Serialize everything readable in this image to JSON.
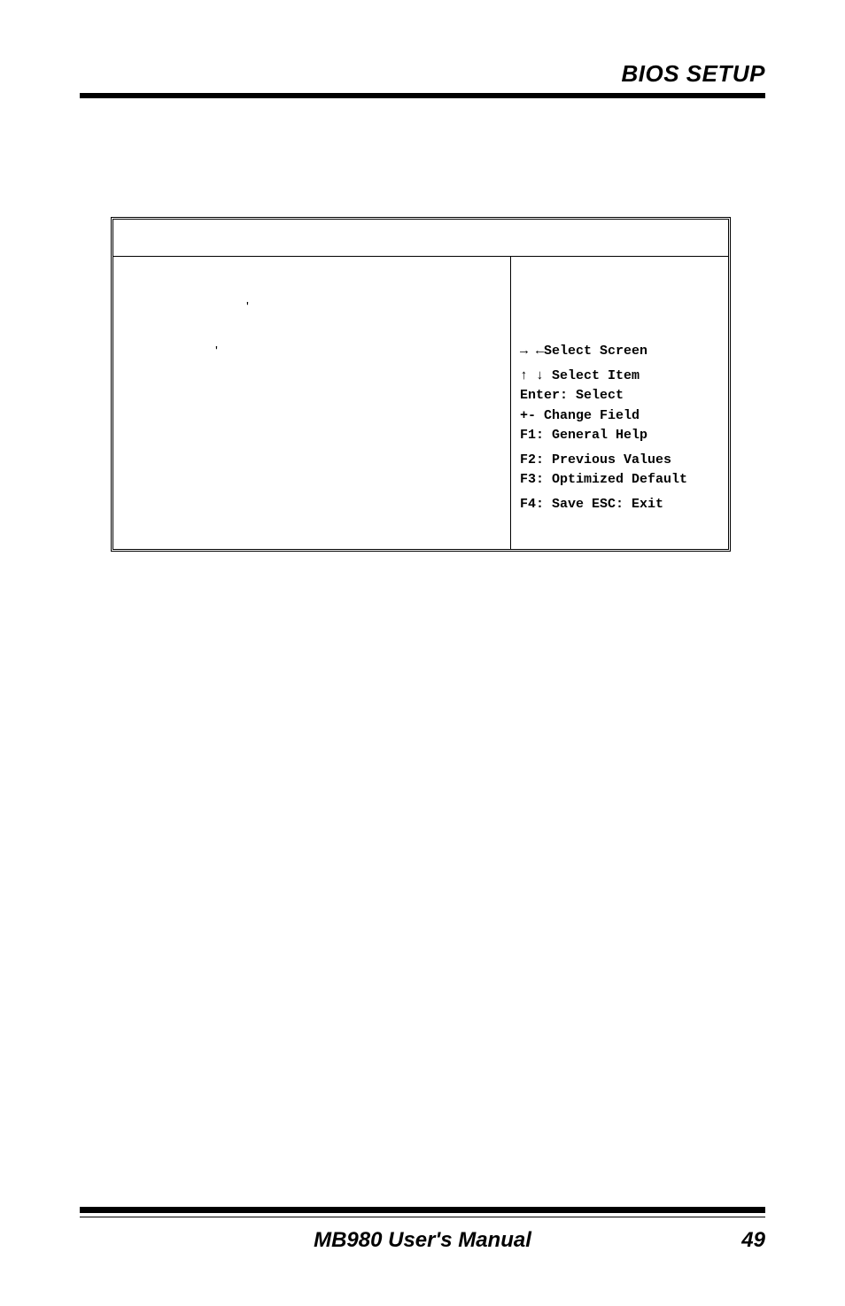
{
  "header": {
    "title": "BIOS SETUP"
  },
  "bios": {
    "help": {
      "select_screen": "→ ←Select Screen",
      "select_item": "↑ ↓ Select Item",
      "enter": "Enter: Select",
      "change_field": "+-  Change Field",
      "general_help": "F1: General Help",
      "previous_values": "F2: Previous Values",
      "optimized_default": "F3: Optimized Default",
      "save_exit": "F4: Save  ESC: Exit"
    }
  },
  "footer": {
    "manual_title": "MB980 User's Manual",
    "page_number": "49"
  }
}
